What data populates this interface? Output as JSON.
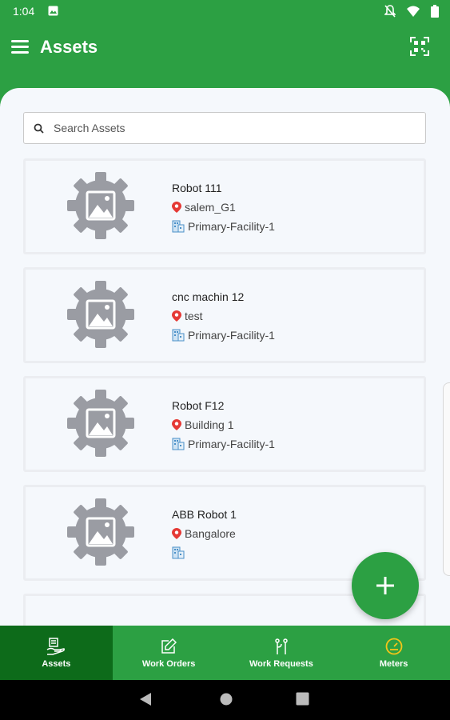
{
  "status": {
    "time": "1:04"
  },
  "header": {
    "title": "Assets"
  },
  "search": {
    "placeholder": "Search Assets"
  },
  "assets": [
    {
      "name": "Robot 111",
      "location": "salem_G1",
      "facility": "Primary-Facility-1"
    },
    {
      "name": "cnc machin 12",
      "location": "test",
      "facility": "Primary-Facility-1"
    },
    {
      "name": "Robot F12",
      "location": "Building 1",
      "facility": "Primary-Facility-1"
    },
    {
      "name": "ABB Robot 1",
      "location": "Bangalore",
      "facility": ""
    }
  ],
  "nav": [
    {
      "label": "Assets",
      "icon": "assets-icon",
      "active": true
    },
    {
      "label": "Work Orders",
      "icon": "work-orders-icon",
      "active": false
    },
    {
      "label": "Work Requests",
      "icon": "work-requests-icon",
      "active": false
    },
    {
      "label": "Meters",
      "icon": "meters-icon",
      "active": false
    }
  ],
  "colors": {
    "primary": "#2ca043",
    "active_tab": "#0d6b1a",
    "location_pin": "#e53935",
    "building": "#4a90c8"
  }
}
